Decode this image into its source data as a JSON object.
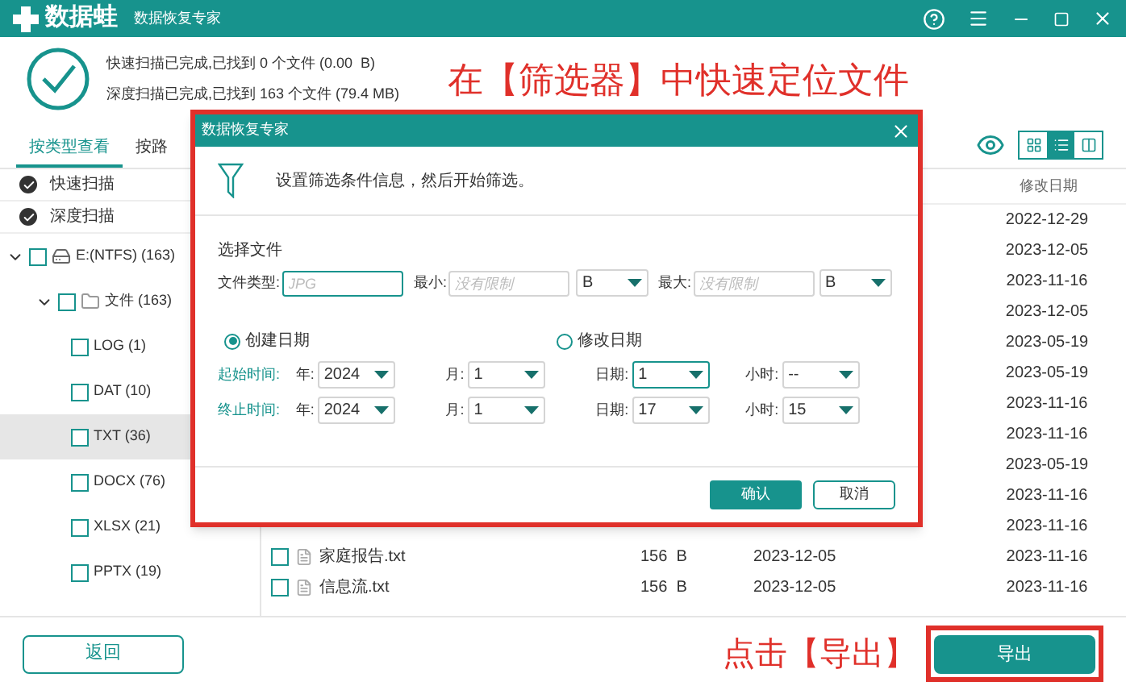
{
  "title_bar": {
    "logo": "数据蛙",
    "app_name": "数据恢复专家"
  },
  "scan_summary": [
    "快速扫描已完成,已找到 0 个文件 (0.00  B)",
    "深度扫描已完成,已找到 163 个文件 (79.4 MB)"
  ],
  "annotation_top": "在【筛选器】中快速定位文件",
  "view_tabs": [
    {
      "label": "按类型查看",
      "selected": true
    },
    {
      "label": "按路",
      "selected": false
    }
  ],
  "view_modes": [
    {
      "kind": "grid",
      "selected": false
    },
    {
      "kind": "list",
      "selected": true
    },
    {
      "kind": "columns",
      "selected": false
    }
  ],
  "scan_types": [
    {
      "label": "快速扫描",
      "checked": true
    },
    {
      "label": "深度扫描",
      "checked": true
    }
  ],
  "tree": [
    {
      "label": "E:(NTFS) (163)",
      "kind": "drive",
      "expanded": true,
      "checked": false,
      "selected": false,
      "children": [
        {
          "label": "文件 (163)",
          "kind": "folder",
          "expanded": true,
          "checked": false,
          "selected": false,
          "children": [
            {
              "label": "LOG (1)",
              "kind": "type",
              "checked": false,
              "selected": false
            },
            {
              "label": "DAT (10)",
              "kind": "type",
              "checked": false,
              "selected": false
            },
            {
              "label": "TXT (36)",
              "kind": "type",
              "checked": false,
              "selected": true
            },
            {
              "label": "DOCX (76)",
              "kind": "type",
              "checked": false,
              "selected": false
            },
            {
              "label": "XLSX (21)",
              "kind": "type",
              "checked": false,
              "selected": false
            },
            {
              "label": "PPTX (19)",
              "kind": "type",
              "checked": false,
              "selected": false
            }
          ]
        }
      ]
    }
  ],
  "file_list": {
    "columns": [
      "修改日期"
    ],
    "rows": [
      {
        "modified": "2022-12-29"
      },
      {
        "modified": "2023-12-05"
      },
      {
        "modified": "2023-11-16"
      },
      {
        "modified": "2023-12-05"
      },
      {
        "modified": "2023-05-19"
      },
      {
        "modified": "2023-05-19"
      },
      {
        "modified": "2023-11-16"
      },
      {
        "modified": "2023-11-16"
      },
      {
        "modified": "2023-05-19"
      },
      {
        "modified": "2023-11-16"
      },
      {
        "modified": "2023-11-16"
      },
      {
        "name": "家庭报告.txt",
        "checked": false,
        "size": "156  B",
        "created": "2023-12-05",
        "modified": "2023-11-16"
      },
      {
        "name": "信息流.txt",
        "checked": false,
        "size": "156  B",
        "created": "2023-12-05",
        "modified": "2023-11-16"
      }
    ]
  },
  "dialog": {
    "title": "数据恢复专家",
    "message": "设置筛选条件信息，然后开始筛选。",
    "section_title": "选择文件",
    "file_type": {
      "label": "文件类型:",
      "placeholder": "JPG"
    },
    "min": {
      "label": "最小:",
      "placeholder": "没有限制",
      "unit": "B"
    },
    "max": {
      "label": "最大:",
      "placeholder": "没有限制",
      "unit": "B"
    },
    "date_modes": [
      {
        "label": "创建日期",
        "selected": true
      },
      {
        "label": "修改日期",
        "selected": false
      }
    ],
    "time_rows": [
      {
        "label": "起始时间:",
        "fields": [
          {
            "label": "年:",
            "value": "2024",
            "focused": false
          },
          {
            "label": "月:",
            "value": "1",
            "focused": false
          },
          {
            "label": "日期:",
            "value": "1",
            "focused": true
          },
          {
            "label": "小时:",
            "value": "--",
            "focused": false
          }
        ]
      },
      {
        "label": "终止时间:",
        "fields": [
          {
            "label": "年:",
            "value": "2024",
            "focused": false
          },
          {
            "label": "月:",
            "value": "1",
            "focused": false
          },
          {
            "label": "日期:",
            "value": "17",
            "focused": false
          },
          {
            "label": "小时:",
            "value": "15",
            "focused": false
          }
        ]
      }
    ],
    "confirm_button": "确认",
    "cancel_button": "取消"
  },
  "footer": {
    "back_button": "返回",
    "annotation": "点击【导出】",
    "export_button": "导出"
  }
}
